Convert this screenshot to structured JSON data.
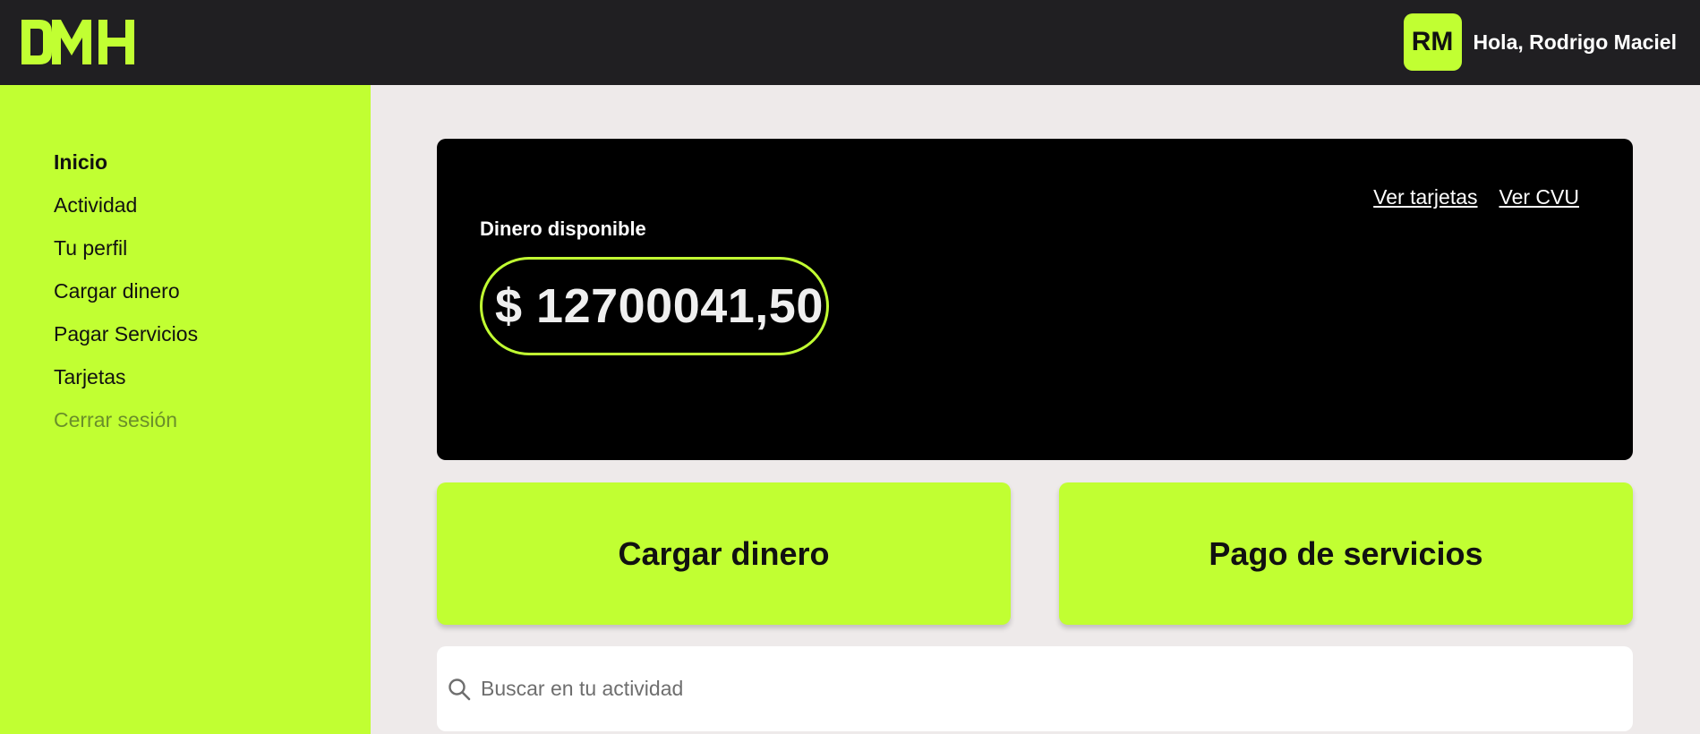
{
  "brand": {
    "logo_text": "DMH",
    "accent_color": "#c1ff32"
  },
  "header": {
    "avatar_initials": "RM",
    "greeting": "Hola, Rodrigo Maciel"
  },
  "sidebar": {
    "items": [
      {
        "label": "Inicio"
      },
      {
        "label": "Actividad"
      },
      {
        "label": "Tu perfil"
      },
      {
        "label": "Cargar dinero"
      },
      {
        "label": "Pagar Servicios"
      },
      {
        "label": "Tarjetas"
      },
      {
        "label": "Cerrar sesión"
      }
    ]
  },
  "balance": {
    "label": "Dinero disponible",
    "amount": "$ 12700041,50",
    "link_cards": "Ver tarjetas",
    "link_cvu": "Ver CVU"
  },
  "actions": {
    "load": "Cargar dinero",
    "pay": "Pago de servicios"
  },
  "search": {
    "placeholder": "Buscar en tu actividad",
    "value": ""
  }
}
